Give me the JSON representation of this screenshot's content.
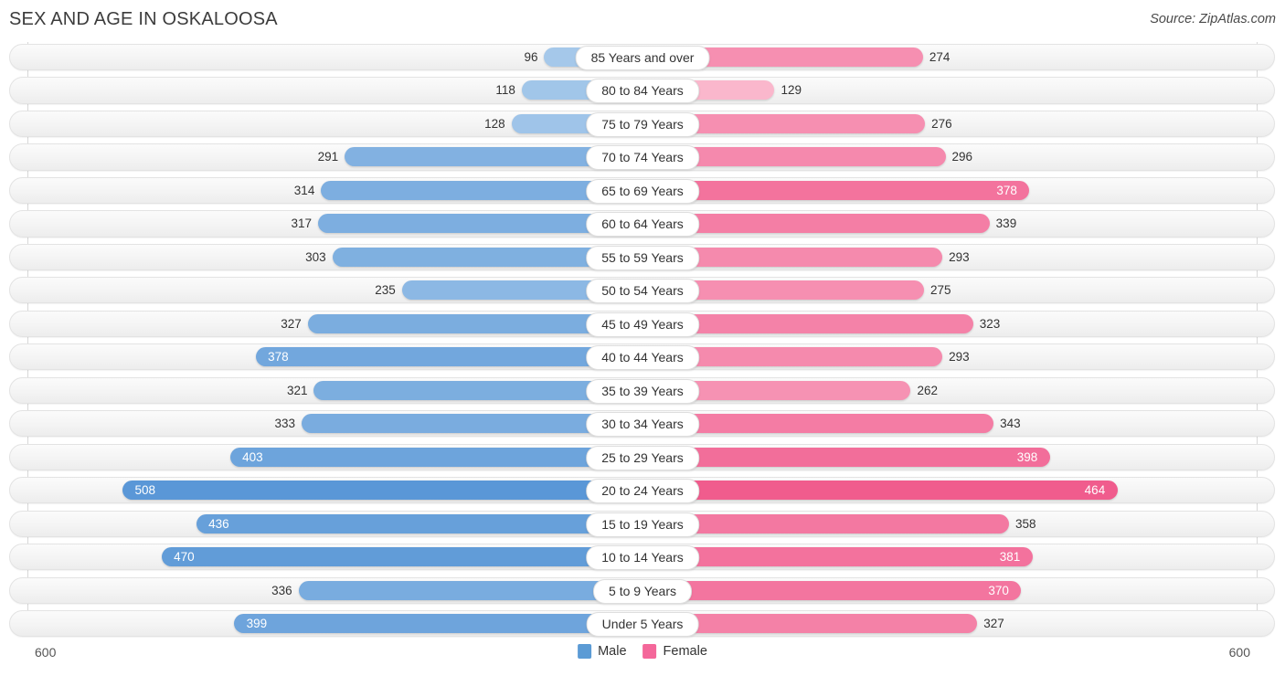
{
  "header": {
    "title": "SEX AND AGE IN OSKALOOSA",
    "source": "Source: ZipAtlas.com"
  },
  "legend": {
    "male_label": "Male",
    "female_label": "Female",
    "male_color": "#5b9bd5",
    "female_color": "#f4679a"
  },
  "axis": {
    "left_max_label": "600",
    "right_max_label": "600",
    "max": 600
  },
  "chart_data": {
    "type": "bar",
    "subtype": "population-pyramid",
    "title": "SEX AND AGE IN OSKALOOSA",
    "xlabel": "",
    "ylabel": "",
    "xlim": [
      600,
      600
    ],
    "grid": false,
    "legend_position": "bottom-center",
    "categories": [
      "85 Years and over",
      "80 to 84 Years",
      "75 to 79 Years",
      "70 to 74 Years",
      "65 to 69 Years",
      "60 to 64 Years",
      "55 to 59 Years",
      "50 to 54 Years",
      "45 to 49 Years",
      "40 to 44 Years",
      "35 to 39 Years",
      "30 to 34 Years",
      "25 to 29 Years",
      "20 to 24 Years",
      "15 to 19 Years",
      "10 to 14 Years",
      "5 to 9 Years",
      "Under 5 Years"
    ],
    "series": [
      {
        "name": "Male",
        "color": "#5b9bd5",
        "values": [
          96,
          118,
          128,
          291,
          314,
          317,
          303,
          235,
          327,
          378,
          321,
          333,
          403,
          508,
          436,
          470,
          336,
          399
        ]
      },
      {
        "name": "Female",
        "color": "#f4679a",
        "values": [
          274,
          129,
          276,
          296,
          378,
          339,
          293,
          275,
          323,
          293,
          262,
          343,
          398,
          464,
          358,
          381,
          370,
          327
        ]
      }
    ]
  },
  "rows": [
    {
      "age": "85 Years and over",
      "male": 96,
      "female": 274,
      "male_inside": false,
      "female_inside": false
    },
    {
      "age": "80 to 84 Years",
      "male": 118,
      "female": 129,
      "male_inside": false,
      "female_inside": false
    },
    {
      "age": "75 to 79 Years",
      "male": 128,
      "female": 276,
      "male_inside": false,
      "female_inside": false
    },
    {
      "age": "70 to 74 Years",
      "male": 291,
      "female": 296,
      "male_inside": false,
      "female_inside": false
    },
    {
      "age": "65 to 69 Years",
      "male": 314,
      "female": 378,
      "male_inside": false,
      "female_inside": true
    },
    {
      "age": "60 to 64 Years",
      "male": 317,
      "female": 339,
      "male_inside": false,
      "female_inside": false
    },
    {
      "age": "55 to 59 Years",
      "male": 303,
      "female": 293,
      "male_inside": false,
      "female_inside": false
    },
    {
      "age": "50 to 54 Years",
      "male": 235,
      "female": 275,
      "male_inside": false,
      "female_inside": false
    },
    {
      "age": "45 to 49 Years",
      "male": 327,
      "female": 323,
      "male_inside": false,
      "female_inside": false
    },
    {
      "age": "40 to 44 Years",
      "male": 378,
      "female": 293,
      "male_inside": true,
      "female_inside": false
    },
    {
      "age": "35 to 39 Years",
      "male": 321,
      "female": 262,
      "male_inside": false,
      "female_inside": false
    },
    {
      "age": "30 to 34 Years",
      "male": 333,
      "female": 343,
      "male_inside": false,
      "female_inside": false
    },
    {
      "age": "25 to 29 Years",
      "male": 403,
      "female": 398,
      "male_inside": true,
      "female_inside": true
    },
    {
      "age": "20 to 24 Years",
      "male": 508,
      "female": 464,
      "male_inside": true,
      "female_inside": true
    },
    {
      "age": "15 to 19 Years",
      "male": 436,
      "female": 358,
      "male_inside": true,
      "female_inside": false
    },
    {
      "age": "10 to 14 Years",
      "male": 470,
      "female": 381,
      "male_inside": true,
      "female_inside": true
    },
    {
      "age": "5 to 9 Years",
      "male": 336,
      "female": 370,
      "male_inside": false,
      "female_inside": true
    },
    {
      "age": "Under 5 Years",
      "male": 399,
      "female": 327,
      "male_inside": true,
      "female_inside": false
    }
  ]
}
